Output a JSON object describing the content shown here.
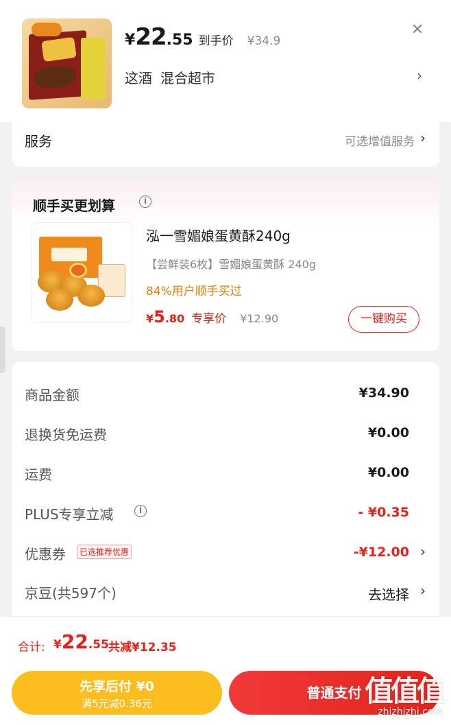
{
  "product": {
    "yen": "¥",
    "price_int": "22",
    "price_dec": ".55",
    "price_tag": "到手价",
    "orig_price": "¥34.9",
    "spec_1": "这酒",
    "spec_2": "混合超市",
    "close_glyph": "✕",
    "chevron": "›"
  },
  "service": {
    "label": "服务",
    "hint": "可选增值服务",
    "chevron": "›"
  },
  "bundle": {
    "title": "顺手买更划算",
    "info_glyph": "i",
    "name": "泓一雪媚娘蛋黄酥240g",
    "spec": "【尝鲜装6枚】雪媚娘蛋黄酥 240g",
    "popularity": "84%用户顺手买过",
    "yen": "¥",
    "price_int": "5",
    "price_dec": ".80",
    "price_tag": "专享价",
    "orig_price": "¥12.90",
    "buy_label": "一键购买"
  },
  "summary": {
    "rows": [
      {
        "label": "商品金额",
        "value": "¥34.90"
      },
      {
        "label": "退换货免运费",
        "value": "¥0.00"
      },
      {
        "label": "运费",
        "value": "¥0.00"
      },
      {
        "label": "PLUS专享立减",
        "value": "- ¥0.35"
      },
      {
        "label": "优惠券",
        "badge": "已选推荐优惠",
        "value": "-¥12.00"
      },
      {
        "label": "京豆(共597个)",
        "value": "去选择"
      }
    ],
    "info_glyph": "i",
    "chevron": "›"
  },
  "total": {
    "label": "合计:",
    "yen": "¥",
    "price_int": "22",
    "price_dec": ".55",
    "save": "共减¥12.35"
  },
  "actions": {
    "pay_later_title": "先享后付 ¥0",
    "pay_later_sub": "满5元减0.36元",
    "pay_normal": "普通支付"
  },
  "watermark": {
    "logo": "值值值",
    "url": "zhizhizhi.com"
  },
  "colors": {
    "accent_red": "#e2231a",
    "accent_orange": "#e0820f",
    "pay_later_yellow": "#fcbd1e"
  }
}
